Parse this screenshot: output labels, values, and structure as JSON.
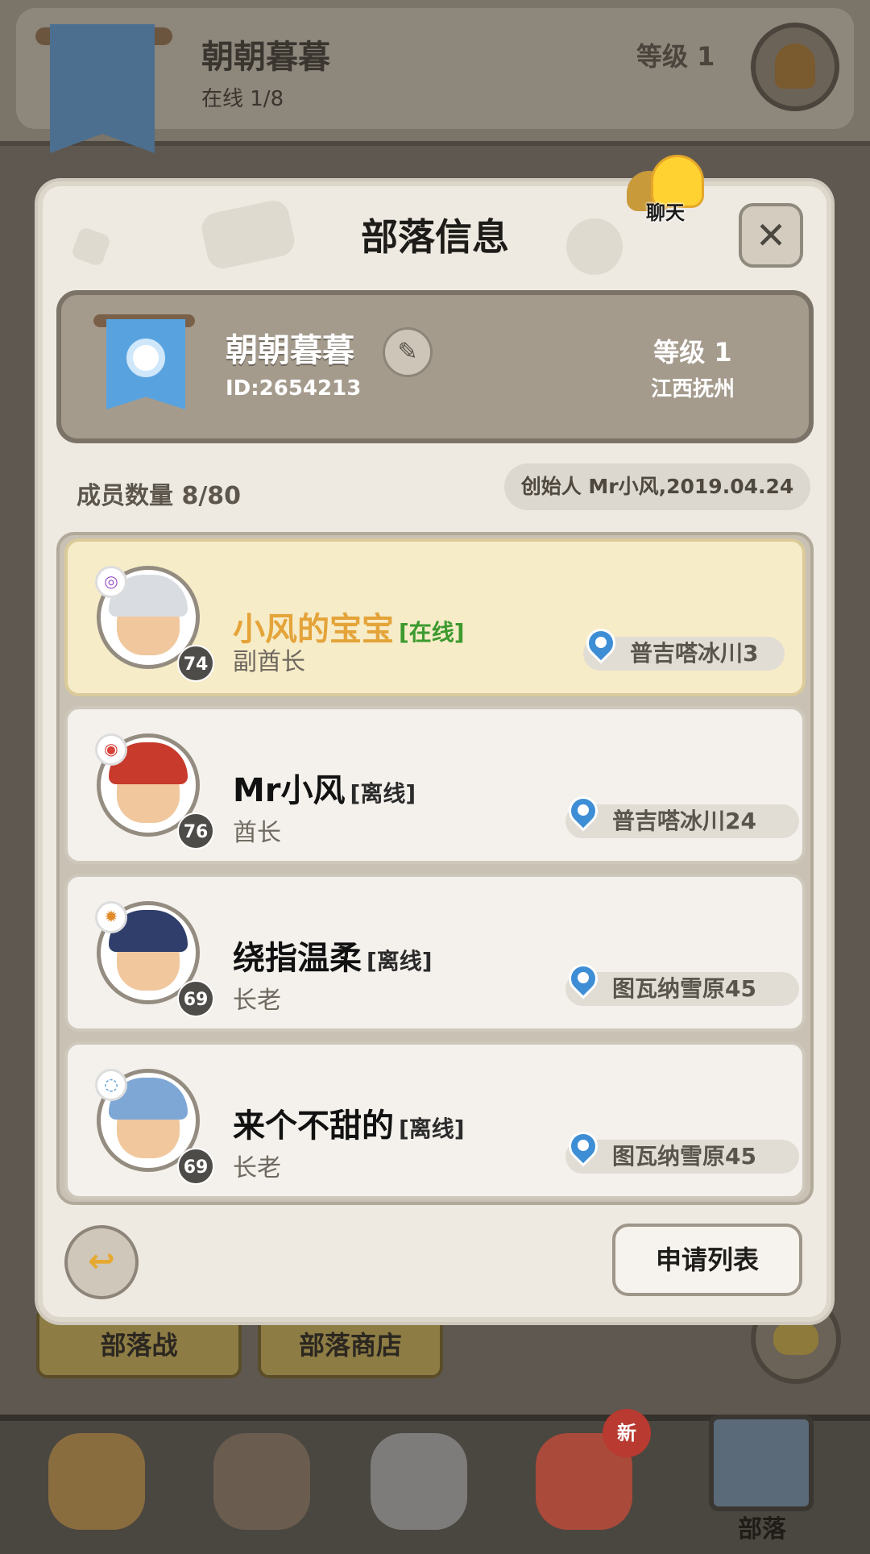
{
  "background": {
    "tribe_name": "朝朝暮暮",
    "online": "在线 1/8",
    "level": "等级 1",
    "tabs": [
      "部落战",
      "部落商店"
    ],
    "nav": {
      "new_badge": "新",
      "active_label": "部落"
    }
  },
  "dialog": {
    "title": "部落信息",
    "chat_label": "聊天",
    "close_symbol": "✕",
    "tribe": {
      "name": "朝朝暮暮",
      "id": "ID:2654213",
      "level": "等级 1",
      "region": "江西抚州"
    },
    "member_count": "成员数量 8/80",
    "founder": "创始人 Mr小风,2019.04.24",
    "members": [
      {
        "name": "小风的宝宝",
        "status": "[在线]",
        "role": "副酋长",
        "level": "74",
        "location": "普吉嗒冰川3",
        "online": true
      },
      {
        "name": "Mr小风",
        "status": "[离线]",
        "role": "酋长",
        "level": "76",
        "location": "普吉嗒冰川24",
        "online": false
      },
      {
        "name": "绕指温柔",
        "status": "[离线]",
        "role": "长老",
        "level": "69",
        "location": "图瓦纳雪原45",
        "online": false
      },
      {
        "name": "来个不甜的",
        "status": "[离线]",
        "role": "长老",
        "level": "69",
        "location": "图瓦纳雪原45",
        "online": false
      }
    ],
    "apply_button": "申请列表"
  },
  "colors": {
    "online_green": "#3c9a2e",
    "highlight_gold": "#e4a43a",
    "panel_bg": "#eeeae2"
  }
}
